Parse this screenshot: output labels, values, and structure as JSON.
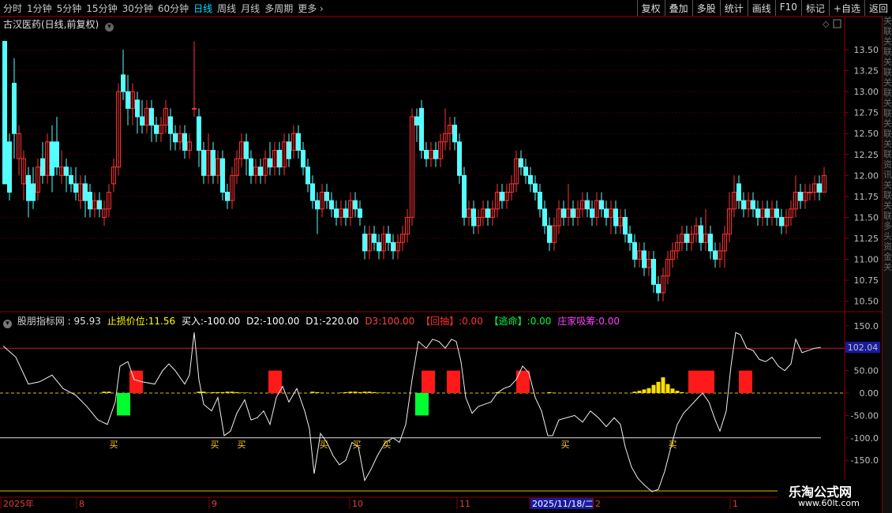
{
  "toolbar": {
    "tabs": [
      "分时",
      "1分钟",
      "5分钟",
      "15分钟",
      "30分钟",
      "60分钟",
      "日线",
      "周线",
      "月线",
      "多周期",
      "更多"
    ],
    "active_tab": "日线",
    "right_buttons": [
      "复权",
      "叠加",
      "多股",
      "统计",
      "画线",
      "F10",
      "标记",
      "+自选",
      "返回"
    ]
  },
  "main_chart": {
    "title": "古汉医药(日线,前复权)",
    "price_ticks": [
      "13.50",
      "13.25",
      "13.00",
      "12.75",
      "12.50",
      "12.25",
      "12.00",
      "11.75",
      "11.50",
      "11.25",
      "11.00",
      "10.75",
      "10.50"
    ],
    "up_color": "#ff3232",
    "down_color": "#54ffff"
  },
  "indicator": {
    "name": "股朋指标网",
    "value": "95.93",
    "stop_label": "止损价位:",
    "stop_value": "11.56",
    "buy_label": "买入:",
    "buy_value": "-100.00",
    "d2_label": "D2:",
    "d2_value": "-100.00",
    "d1_label": "D1:",
    "d1_value": "-220.00",
    "d3_label": "D3:",
    "d3_value": "100.00",
    "huichou_label": "【回抽】:",
    "huichou_value": "0.00",
    "taoming_label": "【逃命】:",
    "taoming_value": "0.00",
    "zhuang_label": "庄家吸筹:",
    "zhuang_value": "0.00",
    "ticks": [
      "150.0",
      "100.0",
      "50.00",
      "0.00",
      "-50.00",
      "-100.0",
      "-150.0"
    ],
    "current_value_badge": "102.04",
    "buy_marker": "买"
  },
  "date_axis": {
    "labels": [
      "2025年",
      "8",
      "9",
      "10",
      "11",
      "2025/11/18/二",
      "2",
      "1"
    ]
  },
  "right_strip_chars": [
    "关",
    "联",
    "关",
    "联",
    "关",
    "联",
    "关",
    "联",
    "关",
    "联",
    "关",
    "联",
    "关",
    "联",
    "资",
    "讯",
    "关",
    "联",
    "关",
    "联",
    "多",
    "头",
    "资",
    "金",
    "关"
  ],
  "watermark": {
    "line1": "乐淘公式网",
    "line2": "www.60lt.com"
  }
}
